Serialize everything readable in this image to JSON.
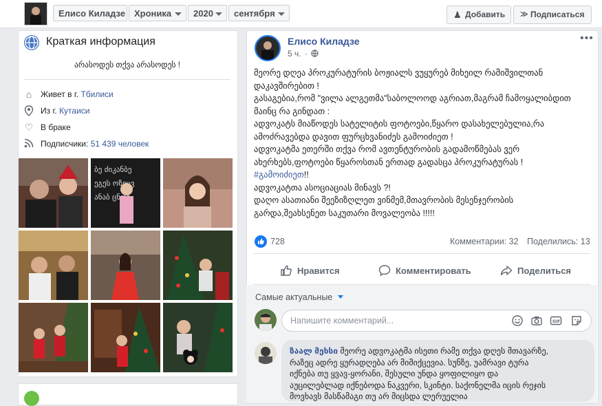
{
  "header": {
    "profile_name": "Елисо Киладзе",
    "section": "Хроника",
    "year": "2020",
    "month": "сентября",
    "add_label": "Добавить",
    "subscribe_label": "Подписаться"
  },
  "intro": {
    "title": "Краткая информация",
    "bio": "არასოდეს თქვა არასოდეს !",
    "lives_in_prefix": "Живет в г.",
    "lives_in_city": "Тбилиси",
    "from_prefix": "Из г.",
    "from_city": "Кутаиси",
    "relationship": "В браке",
    "followers_prefix": "Подписчики:",
    "followers_count": "51 439 человек"
  },
  "photos": [
    {
      "name": "photo-1"
    },
    {
      "name": "photo-2"
    },
    {
      "name": "photo-3"
    },
    {
      "name": "photo-4"
    },
    {
      "name": "photo-5"
    },
    {
      "name": "photo-6"
    },
    {
      "name": "photo-7"
    },
    {
      "name": "photo-8"
    },
    {
      "name": "photo-9"
    }
  ],
  "post": {
    "author": "Елисо Киладзе",
    "time": "5 ч.",
    "lines": [
      "მეორე დღეა პროკურატურის ბოჟიალს ვუყურებ მიხეილ რამიშვილთან",
      "დაკავშირებით !",
      "გასაგებია,რომ \"ვილა ალგეთმა\"საბოლოოდ აგრიათ,მაგრამ ჩამოყალიბდით",
      "მაინც რა გინდათ :",
      "ადვოკატს მიაწოდეს სატელიტის ფოტოები,წყარო დასახელებულია,რა",
      "ამოძრავებდა დავით ფურცხვანიძეს გამოიძიეთ !",
      "ადვოკატმა ეთერში თქვა რომ ავთენტურობის გადამოწმებას ვერ",
      "ახერხებს,ფოტოები წყაროსთან ერთად გადასცა პროკურატურას !"
    ],
    "hashtag": "#გამოიძიეთ",
    "hashtag_suffix": "!!",
    "lines2": [
      "ადვოკატთა ასოციაციას მინავს ?!",
      "დაღო ასათიანი შეეზიზღლეთ ვინმემ,მთავრობის მესენჯერობის",
      "გარდა,შეახსენეთ საკუთარი მოვალეობა !!!!!"
    ],
    "likes": "728",
    "comments": "Комментарии: 32",
    "shares": "Поделились: 13",
    "like_label": "Нравится",
    "comment_label": "Комментировать",
    "share_label": "Поделиться"
  },
  "comments_section": {
    "sort_label": "Самые актуальные",
    "input_placeholder": "Напишите комментарий...",
    "first_comment_author": "ზაალ მეხსი",
    "first_comment_lines": [
      "მეორე ადვოკატმა ისეთი რამე თქვა დღეს მთავარზე,",
      "რაზეც ადრე ყურადღება არ მიმიქცევია. სუნზე, უამრავი ტურა",
      "იქნება თუ ყვავ-ყორანი, შესული უნდა ყოფილიყო და",
      "აუცილებლად იქნებოდა ნაკვერი, სკინტი. საქონელმა იცის რეჯის",
      "მოვხავს მასწამაგი თუ არ მიცსდა ლერუელია"
    ]
  },
  "colors": {
    "link": "#385898",
    "fb_blue": "#1877f2",
    "background": "#e9ebee"
  }
}
